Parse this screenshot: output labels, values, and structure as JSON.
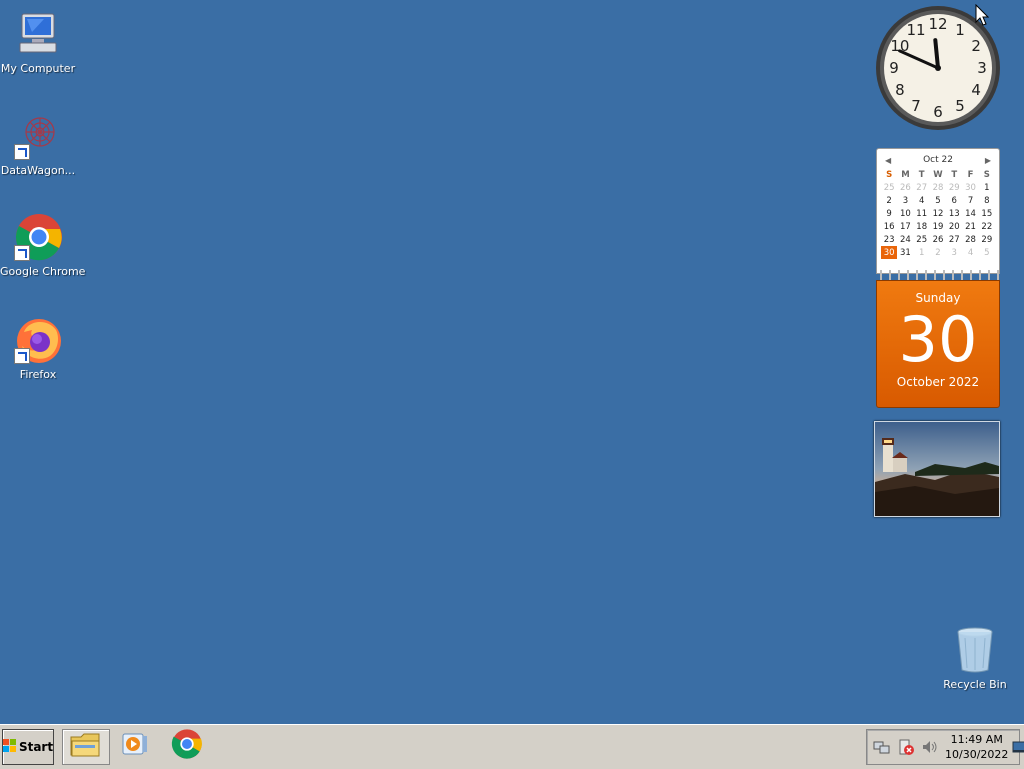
{
  "desktop": {
    "icons": [
      {
        "label": "My Computer",
        "icon": "my-computer-icon"
      },
      {
        "label": "DataWagon...",
        "icon": "datawagon-icon"
      },
      {
        "label": "Google Chrome",
        "icon": "chrome-icon"
      },
      {
        "label": "Firefox",
        "icon": "firefox-icon"
      }
    ],
    "recycle_bin": {
      "label": "Recycle Bin",
      "icon": "recycle-bin-icon"
    }
  },
  "clock_gadget": {
    "numbers": [
      "12",
      "1",
      "2",
      "3",
      "4",
      "5",
      "6",
      "7",
      "8",
      "9",
      "10",
      "11"
    ],
    "hour": 11,
    "minute": 49
  },
  "calendar_gadget": {
    "month_label": "Oct 22",
    "weekday_headers": [
      "S",
      "M",
      "T",
      "W",
      "T",
      "F",
      "S"
    ],
    "rows": [
      [
        "25",
        "26",
        "27",
        "28",
        "29",
        "30",
        "1"
      ],
      [
        "2",
        "3",
        "4",
        "5",
        "6",
        "7",
        "8"
      ],
      [
        "9",
        "10",
        "11",
        "12",
        "13",
        "14",
        "15"
      ],
      [
        "16",
        "17",
        "18",
        "19",
        "20",
        "21",
        "22"
      ],
      [
        "23",
        "24",
        "25",
        "26",
        "27",
        "28",
        "29"
      ],
      [
        "30",
        "31",
        "1",
        "2",
        "3",
        "4",
        "5"
      ]
    ],
    "weekday": "Sunday",
    "day": "30",
    "month_year": "October 2022"
  },
  "taskbar": {
    "start_label": "Start",
    "pinned": [
      "file-explorer-icon",
      "media-player-icon",
      "chrome-icon"
    ],
    "time": "11:49 AM",
    "date": "10/30/2022"
  },
  "colors": {
    "desktop_bg": "#3a6ea5",
    "calendar_accent": "#e9650a",
    "taskbar_bg": "#d4d0c8"
  }
}
